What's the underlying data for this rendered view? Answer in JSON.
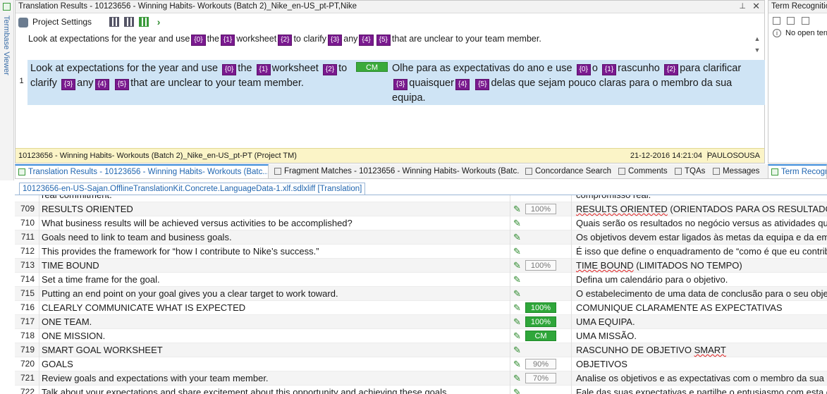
{
  "left_strip": {
    "label": "Termbase Viewer"
  },
  "translation_results": {
    "title": "Translation Results - 10123656 - Winning Habits- Workouts (Batch 2)_Nike_en-US_pt-PT,Nike",
    "project_settings": "Project Settings",
    "source_line": {
      "parts": [
        "Look at expectations for the year and use",
        "{0}",
        "the",
        "{1}",
        "worksheet",
        "{2}",
        "to clarify",
        "{3}",
        "any",
        "{4}",
        "{5}",
        "that are unclear to your team member."
      ]
    },
    "match_number": "1",
    "match_source": {
      "p1": "Look at expectations for the year and use",
      "t0": "{0}",
      "p2": "the",
      "t1": "{1}",
      "p3": "worksheet",
      "t2": "{2}",
      "p4": "to clarify",
      "t3": "{3}",
      "p5": "any",
      "t4": "{4}",
      "t5": "{5}",
      "p6": "that are unclear to your team member."
    },
    "match_badge": "CM",
    "match_target": {
      "p1": "Olhe para as expectativas do ano e use",
      "t0": "{0}",
      "p2": "o",
      "t1": "{1}",
      "p3": "rascunho",
      "t2": "{2}",
      "p4": "para",
      "p5": "clarificar",
      "t3": "{3}",
      "p6": "quaisquer",
      "t4": "{4}",
      "t5": "{5}",
      "p7": "delas que sejam pouco claras para o membro da sua equipa."
    },
    "status": {
      "tm": "10123656 - Winning Habits- Workouts (Batch 2)_Nike_en-US_pt-PT (Project TM)",
      "date": "21-12-2016 14:21:04",
      "user": "PAULOSOUSA"
    }
  },
  "term_recognition": {
    "title": "Term Recognition",
    "info": "No open termbases"
  },
  "tabs": [
    {
      "label": "Translation Results - 10123656 - Winning Habits- Workouts (Batc...",
      "icon": "translation-results-icon"
    },
    {
      "label": "Fragment Matches - 10123656 - Winning Habits- Workouts (Batc...",
      "icon": "fragment-matches-icon"
    },
    {
      "label": "Concordance Search",
      "icon": "concordance-icon"
    },
    {
      "label": "Comments",
      "icon": "comments-icon"
    },
    {
      "label": "TQAs",
      "icon": "tqa-icon"
    },
    {
      "label": "Messages",
      "icon": "messages-icon"
    },
    {
      "label": "Term Recognition",
      "icon": "term-recognition-icon"
    }
  ],
  "document_tab": "10123656-en-US-Sajan.OfflineTranslationKit.Concrete.LanguageData-1.xlf.sdlxliff [Translation]",
  "editor": {
    "partial_top": {
      "source": "real commitment.",
      "target": "compromisso real."
    },
    "rows": [
      {
        "num": "709",
        "source": "RESULTS ORIENTED",
        "match": "100%",
        "match_style": "gray",
        "target": "RESULTS ORIENTED (ORIENTADOS PARA OS RESULTADOS)"
      },
      {
        "num": "710",
        "source": "What business results will be achieved versus activities to be accomplished?",
        "match": "",
        "match_style": "",
        "target": "Quais serão os resultados no negócio versus as atividades que serão realizadas?"
      },
      {
        "num": "711",
        "source": "Goals need to link to team and business goals.",
        "match": "",
        "match_style": "",
        "target": "Os objetivos devem estar ligados às metas da equipa e da empresa."
      },
      {
        "num": "712",
        "source": "This provides the framework for “how I contribute to Nike’s success.”",
        "match": "",
        "match_style": "",
        "target": "É isso que define o enquadramento de “como é que eu contribuo para o sucesso da Nike.”"
      },
      {
        "num": "713",
        "source": "TIME BOUND",
        "match": "100%",
        "match_style": "gray",
        "target": "TIME BOUND (LIMITADOS NO TEMPO)"
      },
      {
        "num": "714",
        "source": "Set a time frame for the goal.",
        "match": "",
        "match_style": "",
        "target": "Defina um calendário para o objetivo."
      },
      {
        "num": "715",
        "source": "Putting an end point on your goal gives you a clear target to work toward.",
        "match": "",
        "match_style": "",
        "target": "O estabelecimento de uma data de conclusão para o seu objetivo dá-lhe uma meta clara."
      },
      {
        "num": "716",
        "source": "CLEARLY COMMUNICATE WHAT IS EXPECTED",
        "match": "100%",
        "match_style": "green",
        "target": "COMUNIQUE CLARAMENTE AS EXPECTATIVAS"
      },
      {
        "num": "717",
        "source": "ONE TEAM.",
        "match": "100%",
        "match_style": "green",
        "target": "UMA EQUIPA."
      },
      {
        "num": "718",
        "source": "ONE MISSION.",
        "match": "CM",
        "match_style": "green",
        "target": "UMA MISSÃO."
      },
      {
        "num": "719",
        "source": "SMART GOAL WORKSHEET",
        "match": "",
        "match_style": "",
        "target": "RASCUNHO DE OBJETIVO SMART"
      },
      {
        "num": "720",
        "source": "GOALS",
        "match": "90%",
        "match_style": "gray",
        "target": "OBJETIVOS"
      },
      {
        "num": "721",
        "source": "Review goals and expectations with your team member.",
        "match": "70%",
        "match_style": "gray",
        "target": "Analise os objetivos e as expectativas com o membro da sua equipa."
      },
      {
        "num": "722",
        "source": "Talk about your expectations and share excitement about this opportunity and achieving these goals.",
        "match": "",
        "match_style": "",
        "target": "Fale das suas expectativas e partilhe o entusiasmo com esta oportunidade."
      }
    ]
  }
}
